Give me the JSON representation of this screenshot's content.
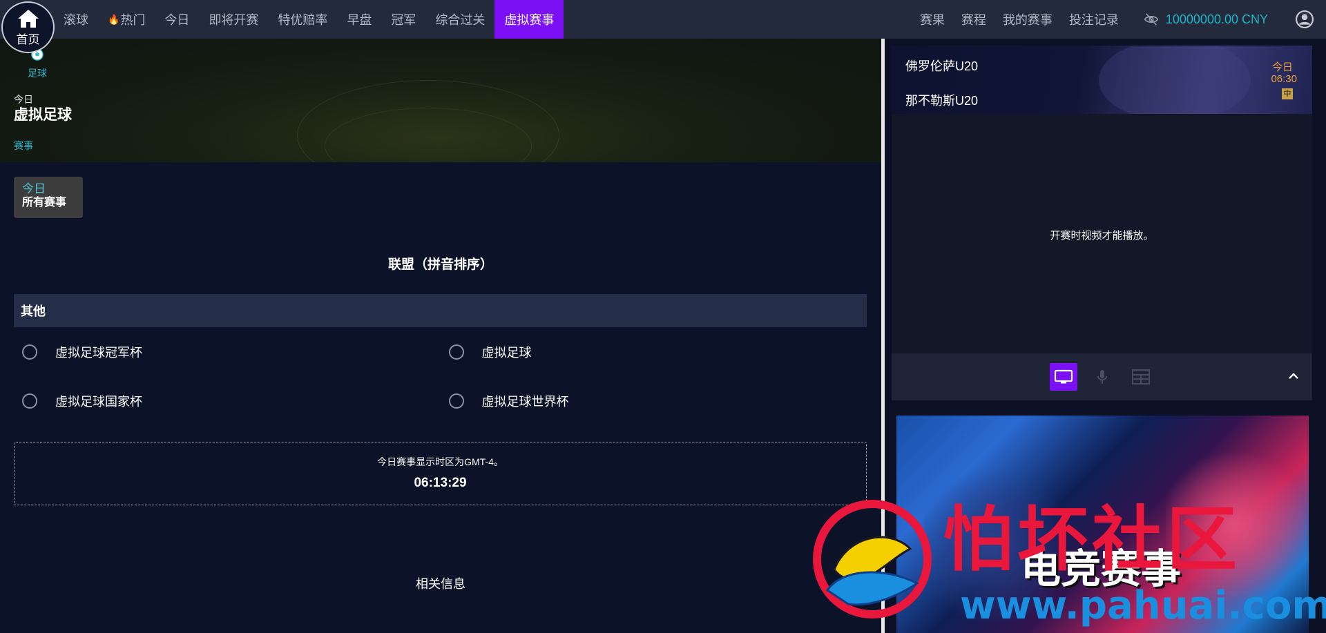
{
  "header": {
    "home_label": "首页",
    "nav_left": [
      {
        "label": "滚球",
        "active": false,
        "hot": false
      },
      {
        "label": "热门",
        "active": false,
        "hot": true
      },
      {
        "label": "今日",
        "active": false,
        "hot": false
      },
      {
        "label": "即将开赛",
        "active": false,
        "hot": false
      },
      {
        "label": "特优赔率",
        "active": false,
        "hot": false
      },
      {
        "label": "早盘",
        "active": false,
        "hot": false
      },
      {
        "label": "冠军",
        "active": false,
        "hot": false
      },
      {
        "label": "综合过关",
        "active": false,
        "hot": false
      },
      {
        "label": "虚拟赛事",
        "active": true,
        "hot": false
      }
    ],
    "nav_right": [
      {
        "label": "赛果"
      },
      {
        "label": "赛程"
      },
      {
        "label": "我的赛事"
      },
      {
        "label": "投注记录"
      }
    ],
    "balance": "10000000.00  CNY",
    "accent_color": "#7b10f5",
    "balance_color": "#1fb5c8"
  },
  "banner": {
    "sport_tab_label": "足球",
    "day": "今日",
    "title": "虚拟足球",
    "sub_link": "赛事"
  },
  "filter": {
    "day": "今日",
    "scope": "所有赛事"
  },
  "leagues": {
    "heading": "联盟（拼音排序）",
    "group_name": "其他",
    "items": [
      "虚拟足球冠军杯",
      "虚拟足球",
      "虚拟足球国家杯",
      "虚拟足球世界杯"
    ]
  },
  "timezone": {
    "text": "今日赛事显示时区为GMT-4。",
    "clock": "06:13:29"
  },
  "related_label": "相关信息",
  "match": {
    "home_team": "佛罗伦萨U20",
    "away_team": "那不勒斯U20",
    "day": "今日",
    "time": "06:30",
    "badge": "中"
  },
  "video": {
    "message": "开赛时视频才能播放。"
  },
  "ad": {
    "title": "电竞赛事"
  },
  "watermark": {
    "text": "怕坏社区",
    "url": "www.pahuai.com"
  }
}
